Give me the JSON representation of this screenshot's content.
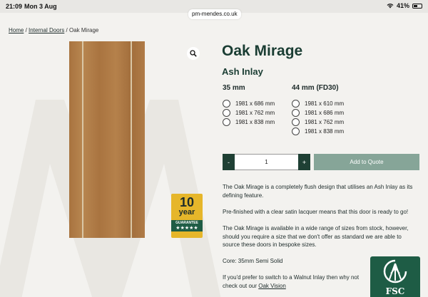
{
  "status_bar": {
    "time": "21:09",
    "date": "Mon 3 Aug",
    "battery": "41%"
  },
  "browser": {
    "url": "pm-mendes.co.uk"
  },
  "breadcrumb": {
    "home": "Home",
    "sep1": "/",
    "internal_doors": "Internal Doors",
    "sep2": "/",
    "current": "Oak Mirage"
  },
  "badge": {
    "number": "10",
    "word": "year",
    "ribbon": "GUARANTEE",
    "stars": "★★★★★"
  },
  "product": {
    "title": "Oak Mirage",
    "subtitle": "Ash Inlay",
    "size_groups": [
      {
        "heading": "35 mm",
        "options": [
          "1981 x 686 mm",
          "1981 x 762 mm",
          "1981 x 838 mm"
        ]
      },
      {
        "heading": "44 mm (FD30)",
        "options": [
          "1981 x 610 mm",
          "1981 x 686 mm",
          "1981 x 762 mm",
          "1981 x 838 mm"
        ]
      }
    ],
    "quantity": {
      "minus": "-",
      "value": "1",
      "plus": "+"
    },
    "add_to_quote": "Add to Quote",
    "description": [
      "The Oak Mirage is a completely flush design that utilises an Ash Inlay as its defining feature.",
      "Pre-finished with a clear satin lacquer means that this door is ready to go!",
      "The Oak Mirage is available in a wide range of sizes from stock, however, should you require a size that we don't offer as standard we are able to source these doors in bespoke sizes.",
      "Core: 35mm Semi Solid"
    ],
    "last_paragraph_text": "If you'd prefer to switch to a Walnut Inlay then why not check out our ",
    "last_paragraph_link": "Oak Vision"
  },
  "fsc_logo": {
    "text": "FSC"
  },
  "colors": {
    "brand_dark": "#1a3d33",
    "button_dark": "#1f4034",
    "quote_button": "#86a598",
    "badge_yellow": "#e6b62a",
    "fsc_green": "#1e5c45"
  }
}
